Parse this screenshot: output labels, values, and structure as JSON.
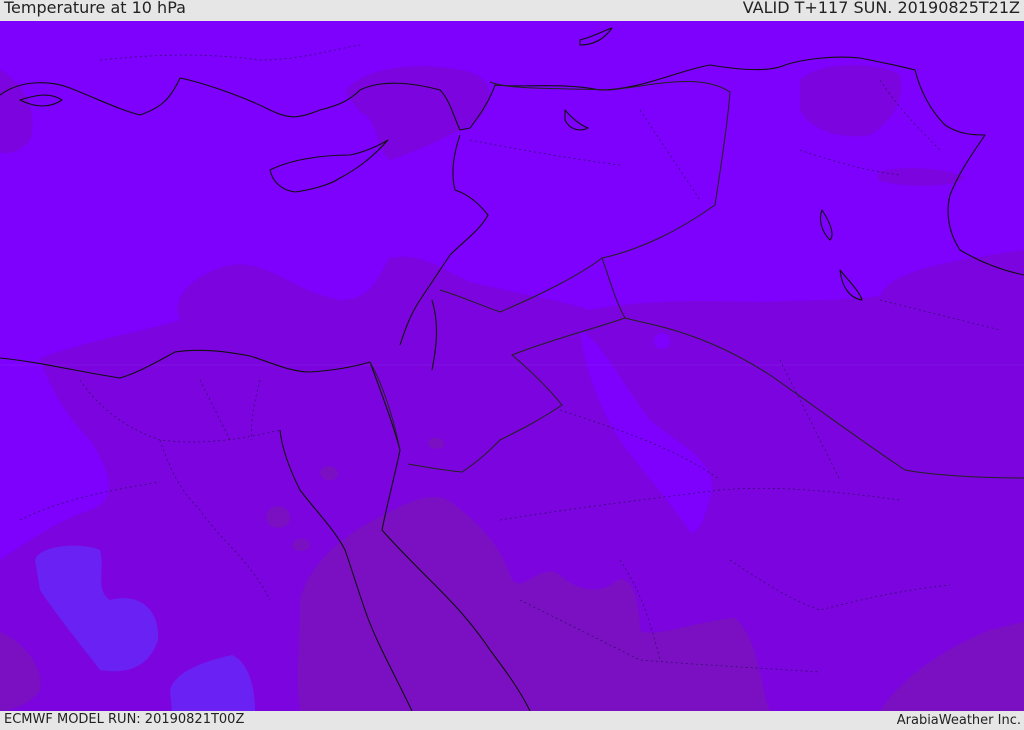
{
  "header": {
    "title": "Temperature at 10 hPa",
    "valid_time": "VALID T+117 SUN. 20190825T21Z"
  },
  "footer": {
    "model_run": "ECMWF MODEL RUN: 20190821T00Z",
    "credit": "ArabiaWeather Inc."
  },
  "colors": {
    "band_cold": "#6a22f4",
    "band_base": "#7e00fd",
    "band_mid": "#7c04de",
    "band_warm": "#7a10c2",
    "coastline": "#111111",
    "border": "#222222"
  }
}
